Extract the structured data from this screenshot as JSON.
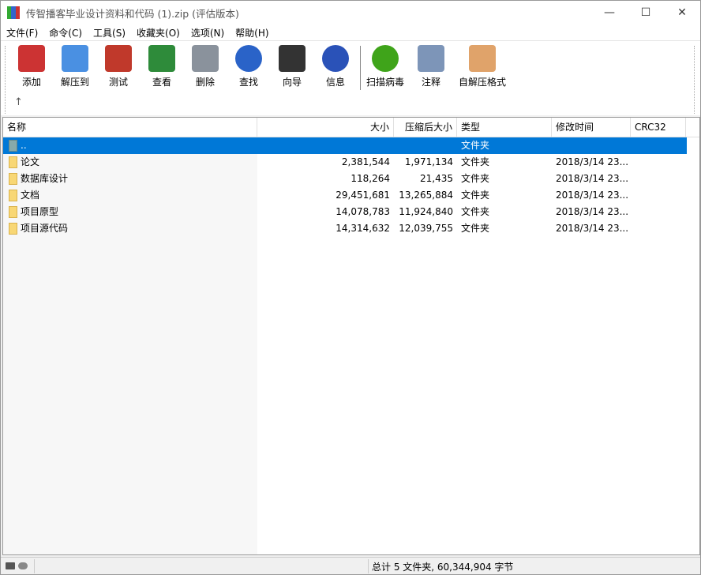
{
  "window": {
    "title": "传智播客毕业设计资料和代码 (1).zip (评估版本)",
    "minimize": "—",
    "maximize": "☐",
    "close": "✕"
  },
  "menu": [
    "文件(F)",
    "命令(C)",
    "工具(S)",
    "收藏夹(O)",
    "选项(N)",
    "帮助(H)"
  ],
  "toolbar": [
    {
      "label": "添加",
      "icon": "add-archive-icon",
      "color": "#c33"
    },
    {
      "label": "解压到",
      "icon": "extract-folder-icon",
      "color": "#4a90e2"
    },
    {
      "label": "测试",
      "icon": "test-clipboard-icon",
      "color": "#c0392b"
    },
    {
      "label": "查看",
      "icon": "view-book-icon",
      "color": "#2e8b3a"
    },
    {
      "label": "删除",
      "icon": "trash-icon",
      "color": "#8a929c"
    },
    {
      "label": "查找",
      "icon": "magnifier-icon",
      "color": "#2a63c8"
    },
    {
      "label": "向导",
      "icon": "wizard-wand-icon",
      "color": "#333"
    },
    {
      "label": "信息",
      "icon": "info-icon",
      "color": "#2a52b8"
    },
    {
      "label": "扫描病毒",
      "icon": "virus-scan-icon",
      "color": "#3fa41a"
    },
    {
      "label": "注释",
      "icon": "comment-icon",
      "color": "#7d95b8"
    },
    {
      "label": "自解压格式",
      "icon": "sfx-box-icon",
      "color": "#e0a36a"
    }
  ],
  "up_arrow": "↑",
  "columns": [
    "名称",
    "大小",
    "压缩后大小",
    "类型",
    "修改时间",
    "CRC32"
  ],
  "rows": [
    {
      "name": "..",
      "size": "",
      "packed": "",
      "type": "文件夹",
      "modified": "",
      "crc": ""
    },
    {
      "name": "论文",
      "size": "2,381,544",
      "packed": "1,971,134",
      "type": "文件夹",
      "modified": "2018/3/14 23...",
      "crc": ""
    },
    {
      "name": "数据库设计",
      "size": "118,264",
      "packed": "21,435",
      "type": "文件夹",
      "modified": "2018/3/14 23...",
      "crc": ""
    },
    {
      "name": "文档",
      "size": "29,451,681",
      "packed": "13,265,884",
      "type": "文件夹",
      "modified": "2018/3/14 23...",
      "crc": ""
    },
    {
      "name": "项目原型",
      "size": "14,078,783",
      "packed": "11,924,840",
      "type": "文件夹",
      "modified": "2018/3/14 23...",
      "crc": ""
    },
    {
      "name": "项目源代码",
      "size": "14,314,632",
      "packed": "12,039,755",
      "type": "文件夹",
      "modified": "2018/3/14 23...",
      "crc": ""
    }
  ],
  "status": {
    "summary": "总计 5 文件夹, 60,344,904 字节"
  }
}
